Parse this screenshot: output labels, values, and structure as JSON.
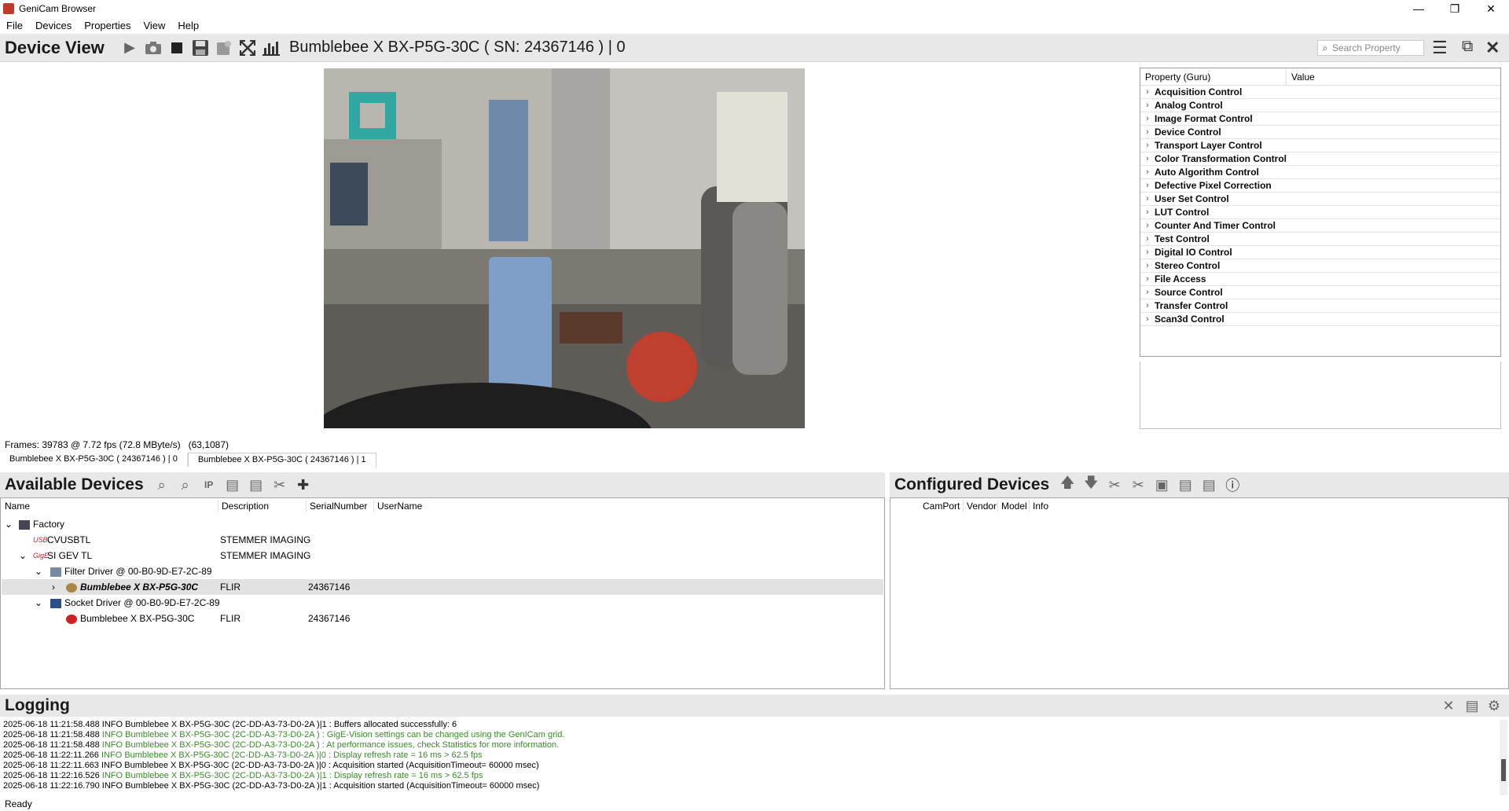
{
  "window": {
    "title": "GeniCam Browser",
    "controls": [
      "—",
      "❐",
      "✕"
    ]
  },
  "menu": [
    "File",
    "Devices",
    "Properties",
    "View",
    "Help"
  ],
  "device_view": {
    "heading": "Device View",
    "device_title": "Bumblebee X BX-P5G-30C ( SN: 24367146 ) | 0",
    "search_placeholder": "Search Property"
  },
  "properties": {
    "col_property": "Property (Guru)",
    "col_value": "Value",
    "categories": [
      "Acquisition Control",
      "Analog Control",
      "Image Format Control",
      "Device Control",
      "Transport Layer Control",
      "Color Transformation Control",
      "Auto Algorithm Control",
      "Defective Pixel Correction",
      "User Set Control",
      "LUT Control",
      "Counter And Timer Control",
      "Test Control",
      "Digital IO Control",
      "Stereo Control",
      "File Access",
      "Source Control",
      "Transfer Control",
      "Scan3d Control"
    ]
  },
  "stats": {
    "frames": "Frames: 39783 @ 7.72 fps (72.8 MByte/s)",
    "coords": "(63,1087)"
  },
  "tabs": [
    "Bumblebee X BX-P5G-30C ( 24367146 ) | 0",
    "Bumblebee X BX-P5G-30C ( 24367146 ) | 1"
  ],
  "available": {
    "heading": "Available Devices",
    "columns": [
      "Name",
      "Description",
      "SerialNumber",
      "UserName"
    ],
    "rows": [
      {
        "name": "Factory",
        "desc": "",
        "serial": ""
      },
      {
        "name": "CVUSBTL",
        "desc": "STEMMER IMAGING",
        "serial": ""
      },
      {
        "name": "SI GEV TL",
        "desc": "STEMMER IMAGING",
        "serial": ""
      },
      {
        "name": "Filter Driver @ 00-B0-9D-E7-2C-89",
        "desc": "",
        "serial": ""
      },
      {
        "name": "Bumblebee X BX-P5G-30C",
        "desc": "FLIR",
        "serial": "24367146"
      },
      {
        "name": "Socket Driver @ 00-B0-9D-E7-2C-89",
        "desc": "",
        "serial": ""
      },
      {
        "name": "Bumblebee X BX-P5G-30C",
        "desc": "FLIR",
        "serial": "24367146"
      }
    ]
  },
  "configured": {
    "heading": "Configured Devices",
    "columns": [
      "CamPort",
      "Vendor",
      "Model",
      "Info"
    ]
  },
  "logging": {
    "heading": "Logging",
    "lines": [
      {
        "prefix": "2025-06-18 11:21:58.488 INFO Bumblebee X BX-P5G-30C (2C-DD-A3-73-D0-2A )|1 : Buffers allocated successfully: 6",
        "rest": ""
      },
      {
        "prefix": "2025-06-18 11:21:58.488 ",
        "rest": "INFO Bumblebee X BX-P5G-30C (2C-DD-A3-73-D0-2A ) : GigE-Vision settings can be changed using the GenICam grid."
      },
      {
        "prefix": "2025-06-18 11:21:58.488 ",
        "rest": "INFO Bumblebee X BX-P5G-30C (2C-DD-A3-73-D0-2A ) : At performance issues, check Statistics for more information."
      },
      {
        "prefix": "2025-06-18 11:22:11.266 ",
        "rest": "INFO Bumblebee X BX-P5G-30C (2C-DD-A3-73-D0-2A )|0 : Display refresh rate = 16 ms > 62.5 fps"
      },
      {
        "prefix": "2025-06-18 11:22:11.663 INFO Bumblebee X BX-P5G-30C (2C-DD-A3-73-D0-2A )|0 : Acquisition started (AcquisitionTimeout= 60000 msec)",
        "rest": ""
      },
      {
        "prefix": "2025-06-18 11:22:16.526 ",
        "rest": "INFO Bumblebee X BX-P5G-30C (2C-DD-A3-73-D0-2A )|1 : Display refresh rate = 16 ms > 62.5 fps"
      },
      {
        "prefix": "2025-06-18 11:22:16.790 INFO Bumblebee X BX-P5G-30C (2C-DD-A3-73-D0-2A )|1 : Acquisition started (AcquisitionTimeout= 60000 msec)",
        "rest": ""
      }
    ]
  },
  "status": "Ready"
}
